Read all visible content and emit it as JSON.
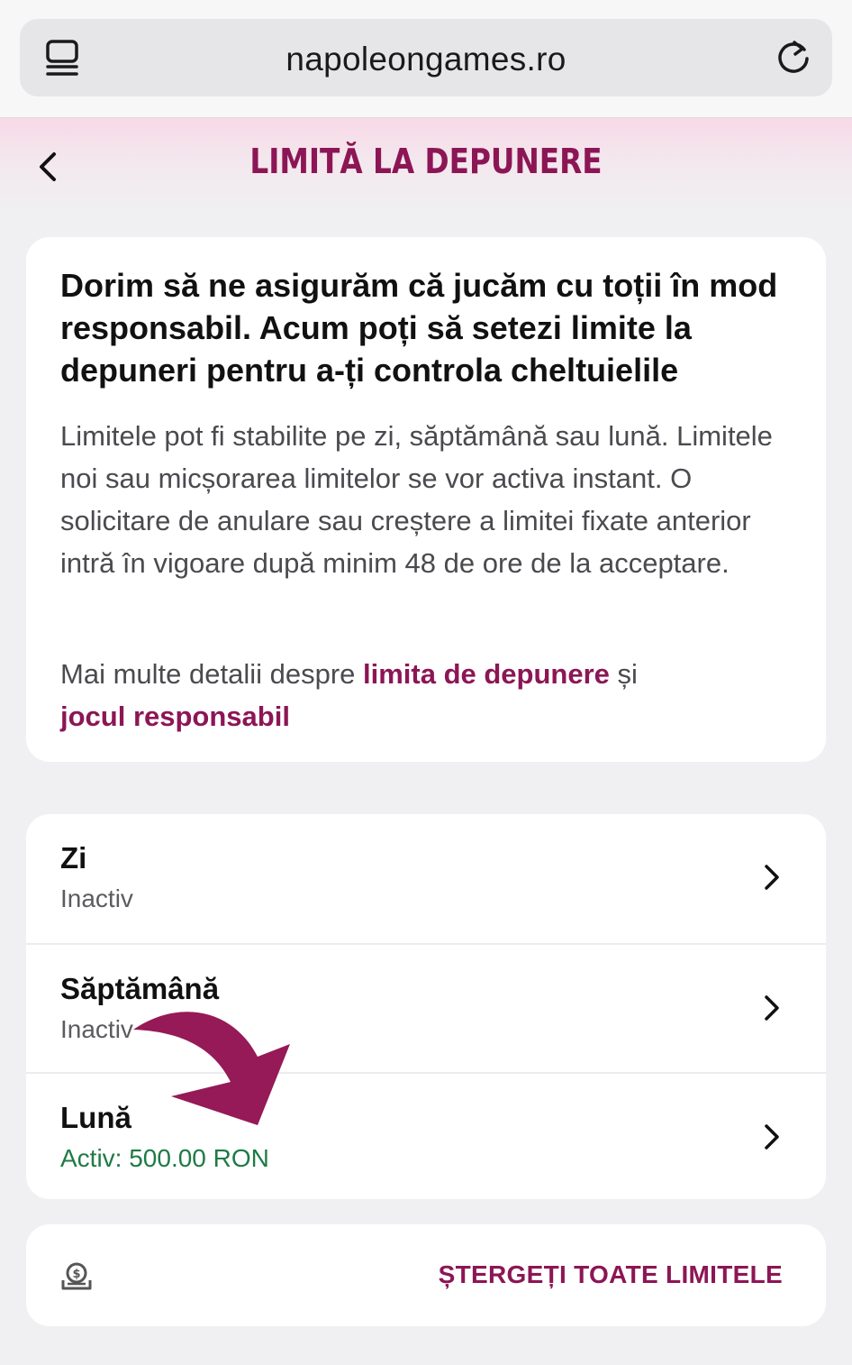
{
  "browser": {
    "url": "napoleongames.ro"
  },
  "header": {
    "title": "LIMITĂ LA DEPUNERE"
  },
  "info": {
    "heading": "Dorim să ne asigurăm că jucăm cu toții în mod responsabil. Acum poți să setezi limite la depuneri pentru a-ți controla cheltuielile",
    "body": "Limitele pot fi stabilite pe zi, săptămână sau lună. Limitele noi sau micșorarea limitelor se vor activa instant. O solicitare de anulare sau creștere a limitei fixate anterior intră în vigoare după minim 48 de ore de la acceptare.",
    "more_prefix": "Mai multe detalii despre ",
    "link_deposit_limit": "limita de depunere",
    "more_middle": " și",
    "link_responsible_play": "jocul responsabil"
  },
  "limits": [
    {
      "name": "Zi",
      "status": "Inactiv"
    },
    {
      "name": "Săptămână",
      "status": "Inactiv"
    },
    {
      "name": "Lună",
      "status": "Activ: 500.00 RON"
    }
  ],
  "actions": {
    "clear_all": "ȘTERGEȚI TOATE LIMITELE"
  },
  "colors": {
    "brand": "#8c1655",
    "active": "#1f7a46"
  },
  "icons": {
    "tabs": "tabs-icon",
    "reload": "reload-icon",
    "back": "back-chevron-icon",
    "row_chevron": "chevron-right-icon",
    "money": "money-icon",
    "annotation": "arrow-annotation-icon"
  }
}
